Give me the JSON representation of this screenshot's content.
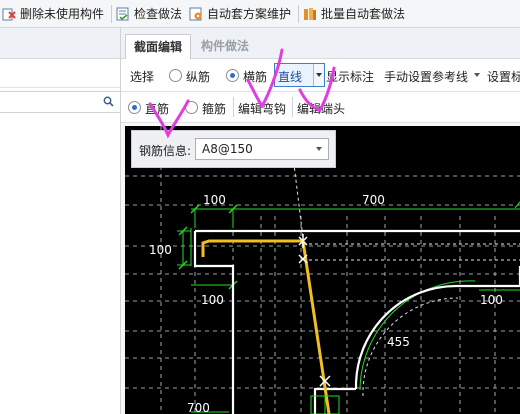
{
  "toolbar": {
    "items": [
      {
        "label": "删除未使用构件",
        "icon": "delete-unused-icon"
      },
      {
        "label": "检查做法",
        "icon": "check-method-icon"
      },
      {
        "label": "自动套方案维护",
        "icon": "auto-scheme-icon"
      },
      {
        "label": "批量自动套做法",
        "icon": "batch-auto-icon"
      }
    ]
  },
  "left_panel": {
    "search_placeholder": ""
  },
  "tabs": [
    {
      "label": "截面编辑",
      "active": true
    },
    {
      "label": "构件做法",
      "active": false
    }
  ],
  "row1": {
    "select_label": "选择",
    "options": [
      {
        "label": "纵筋",
        "selected": false
      },
      {
        "label": "横筋",
        "selected": true
      }
    ],
    "line_combo": "直线",
    "show_annotation": "显示标注",
    "manual_ref": "手动设置参考线",
    "settings": "设置标"
  },
  "row2": {
    "options": [
      {
        "label": "直筋",
        "selected": true
      },
      {
        "label": "箍筋",
        "selected": false
      }
    ],
    "edit_hook": "编辑弯钩",
    "edit_end": "编辑端头"
  },
  "rebar_info": {
    "label": "钢筋信息:",
    "value": "A8@150"
  },
  "drawing": {
    "dimensions": [
      "100",
      "700",
      "100",
      "100",
      "100",
      "455",
      "700"
    ],
    "colors": {
      "background": "#000000",
      "outline": "#ffffff",
      "dimension": "#22dd22",
      "rebar": "#f0c020",
      "grid": "#bfc6d0",
      "annotation_ink": "#e03ce0"
    }
  }
}
